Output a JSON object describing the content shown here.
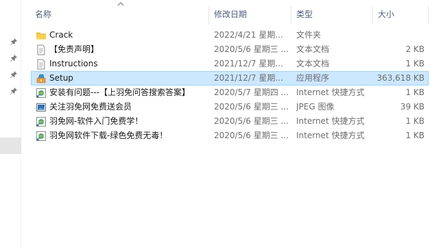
{
  "columns": {
    "name": "名称",
    "date": "修改日期",
    "type": "类型",
    "size": "大小"
  },
  "files": [
    {
      "icon": "folder-icon",
      "name": "Crack",
      "date": "2022/4/21 星期...",
      "type": "文件夹",
      "size": ""
    },
    {
      "icon": "text-document-icon",
      "name": "【免责声明】",
      "date": "2020/5/6 星期三 ...",
      "type": "文本文档",
      "size": "2 KB"
    },
    {
      "icon": "text-document-icon",
      "name": "Instructions",
      "date": "2021/12/7 星期...",
      "type": "文本文档",
      "size": "1 KB"
    },
    {
      "icon": "setup-installer-icon",
      "name": "Setup",
      "date": "2021/12/7 星期...",
      "type": "应用程序",
      "size": "363,618 KB"
    },
    {
      "icon": "internet-shortcut-icon",
      "name": "安装有问题---【上羽免问答搜索答案】",
      "date": "2020/5/7 星期四 ...",
      "type": "Internet 快捷方式",
      "size": "1 KB"
    },
    {
      "icon": "jpeg-image-icon",
      "name": "关注羽免网免费送会员",
      "date": "2020/5/6 星期三 ...",
      "type": "JPEG 图像",
      "size": "39 KB"
    },
    {
      "icon": "internet-shortcut-icon",
      "name": "羽免网-软件入门免费学！",
      "date": "2020/5/6 星期三 ...",
      "type": "Internet 快捷方式",
      "size": "1 KB"
    },
    {
      "icon": "internet-shortcut-icon",
      "name": "羽免网软件下载-绿色免费无毒！",
      "date": "2020/5/6 星期三 ...",
      "type": "Internet 快捷方式",
      "size": "1 KB"
    }
  ],
  "selected_index": 3,
  "colors": {
    "selection_bg": "#cce8ff",
    "selection_border": "#99d1ff",
    "header_text": "#4c607a",
    "folder": "#ffcf48"
  }
}
